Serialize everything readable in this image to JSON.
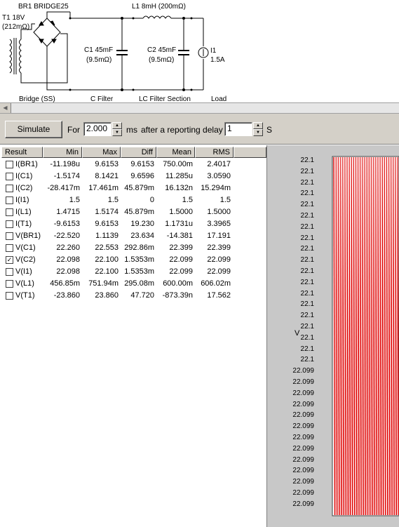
{
  "schematic": {
    "bridge_title": "BR1 BRIDGE25",
    "t1_name": "T1 18V",
    "t1_resistance": "(212mΩ)",
    "l1_label": "L1 8mH (200mΩ)",
    "c1_name": "C1 45mF",
    "c1_resistance": "(9.5mΩ)",
    "c2_name": "C2 45mF",
    "c2_resistance": "(9.5mΩ)",
    "i1_name": "I1",
    "i1_value": "1.5A",
    "section_bridge": "Bridge (SS)",
    "section_cfilter": "C Filter",
    "section_lc": "LC Filter Section",
    "section_load": "Load"
  },
  "toolbar": {
    "simulate_label": "Simulate",
    "for_label": "For",
    "duration_value": "2.000",
    "ms_label": "ms",
    "delay_label": "after a reporting delay of",
    "delay_value": "1",
    "s_label": "S"
  },
  "results": {
    "headers": [
      "Result",
      "Min",
      "Max",
      "Diff",
      "Mean",
      "RMS"
    ],
    "rows": [
      {
        "checked": false,
        "name": "I(BR1)",
        "min": "-11.198u",
        "max": "9.6153",
        "diff": "9.6153",
        "mean": "750.00m",
        "rms": "2.4017"
      },
      {
        "checked": false,
        "name": "I(C1)",
        "min": "-1.5174",
        "max": "8.1421",
        "diff": "9.6596",
        "mean": "11.285u",
        "rms": "3.0590"
      },
      {
        "checked": false,
        "name": "I(C2)",
        "min": "-28.417m",
        "max": "17.461m",
        "diff": "45.879m",
        "mean": "16.132n",
        "rms": "15.294m"
      },
      {
        "checked": false,
        "name": "I(I1)",
        "min": "1.5",
        "max": "1.5",
        "diff": "0",
        "mean": "1.5",
        "rms": "1.5"
      },
      {
        "checked": false,
        "name": "I(L1)",
        "min": "1.4715",
        "max": "1.5174",
        "diff": "45.879m",
        "mean": "1.5000",
        "rms": "1.5000"
      },
      {
        "checked": false,
        "name": "I(T1)",
        "min": "-9.6153",
        "max": "9.6153",
        "diff": "19.230",
        "mean": "1.1731u",
        "rms": "3.3965"
      },
      {
        "checked": false,
        "name": "V(BR1)",
        "min": "-22.520",
        "max": "1.1139",
        "diff": "23.634",
        "mean": "-14.381",
        "rms": "17.191"
      },
      {
        "checked": false,
        "name": "V(C1)",
        "min": "22.260",
        "max": "22.553",
        "diff": "292.86m",
        "mean": "22.399",
        "rms": "22.399"
      },
      {
        "checked": true,
        "name": "V(C2)",
        "min": "22.098",
        "max": "22.100",
        "diff": "1.5353m",
        "mean": "22.099",
        "rms": "22.099"
      },
      {
        "checked": false,
        "name": "V(I1)",
        "min": "22.098",
        "max": "22.100",
        "diff": "1.5353m",
        "mean": "22.099",
        "rms": "22.099"
      },
      {
        "checked": false,
        "name": "V(L1)",
        "min": "456.85m",
        "max": "751.94m",
        "diff": "295.08m",
        "mean": "600.00m",
        "rms": "606.02m"
      },
      {
        "checked": false,
        "name": "V(T1)",
        "min": "-23.860",
        "max": "23.860",
        "diff": "47.720",
        "mean": "-873.39n",
        "rms": "17.562"
      }
    ]
  },
  "chart_data": {
    "type": "line",
    "title": "",
    "ylabel": "V",
    "series": [
      {
        "name": "V(C2)",
        "color": "#e00000"
      }
    ],
    "y_tick_labels": [
      "22.1",
      "22.1",
      "22.1",
      "22.1",
      "22.1",
      "22.1",
      "22.1",
      "22.1",
      "22.1",
      "22.1",
      "22.1",
      "22.1",
      "22.1",
      "22.1",
      "22.1",
      "22.1",
      "22.1",
      "22.1",
      "22.1",
      "22.099",
      "22.099",
      "22.099",
      "22.099",
      "22.099",
      "22.099",
      "22.099",
      "22.099",
      "22.099",
      "22.099",
      "22.099",
      "22.099",
      "22.099"
    ],
    "ylim": [
      22.098,
      22.1
    ],
    "background": "#ffffff",
    "panel_color": "#c8c8c8"
  },
  "icons": {
    "checkmark": "✓",
    "up": "▲",
    "down": "▼",
    "left": "◀"
  }
}
